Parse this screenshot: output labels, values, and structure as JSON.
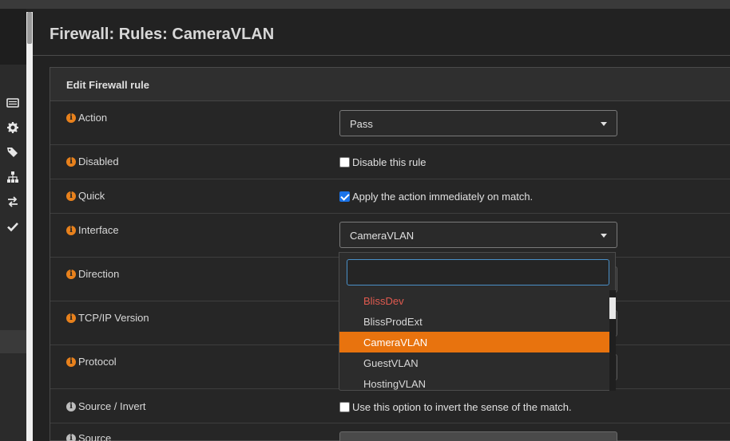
{
  "page": {
    "title": "Firewall: Rules: CameraVLAN"
  },
  "sidebar": {
    "icons": [
      {
        "name": "list-icon"
      },
      {
        "name": "gear-icon"
      },
      {
        "name": "tags-icon"
      },
      {
        "name": "sitemap-icon"
      },
      {
        "name": "exchange-icon"
      },
      {
        "name": "check-icon"
      }
    ]
  },
  "panel": {
    "heading": "Edit Firewall rule",
    "fields": {
      "action": {
        "label": "Action",
        "value": "Pass"
      },
      "disabled": {
        "label": "Disabled",
        "checkbox_label": "Disable this rule",
        "checked": false
      },
      "quick": {
        "label": "Quick",
        "checkbox_label": "Apply the action immediately on match.",
        "checked": true
      },
      "interface": {
        "label": "Interface",
        "value": "CameraVLAN"
      },
      "direction": {
        "label": "Direction"
      },
      "tcpip_version": {
        "label": "TCP/IP Version"
      },
      "protocol": {
        "label": "Protocol"
      },
      "source_invert": {
        "label": "Source / Invert",
        "checkbox_label": "Use this option to invert the sense of the match.",
        "checked": false
      },
      "source": {
        "label": "Source"
      }
    }
  },
  "interface_dropdown": {
    "search_value": "",
    "options": [
      {
        "label": "BlissDev",
        "style": "header"
      },
      {
        "label": "BlissProdExt",
        "style": "normal"
      },
      {
        "label": "CameraVLAN",
        "style": "active"
      },
      {
        "label": "GuestVLAN",
        "style": "normal"
      },
      {
        "label": "HostingVLAN",
        "style": "normal"
      }
    ]
  },
  "colors": {
    "accent_orange": "#e8730e",
    "info_icon": "#e8811c",
    "header_option_red": "#e05a4f",
    "checkbox_blue": "#1a73e8",
    "background": "#222222"
  }
}
